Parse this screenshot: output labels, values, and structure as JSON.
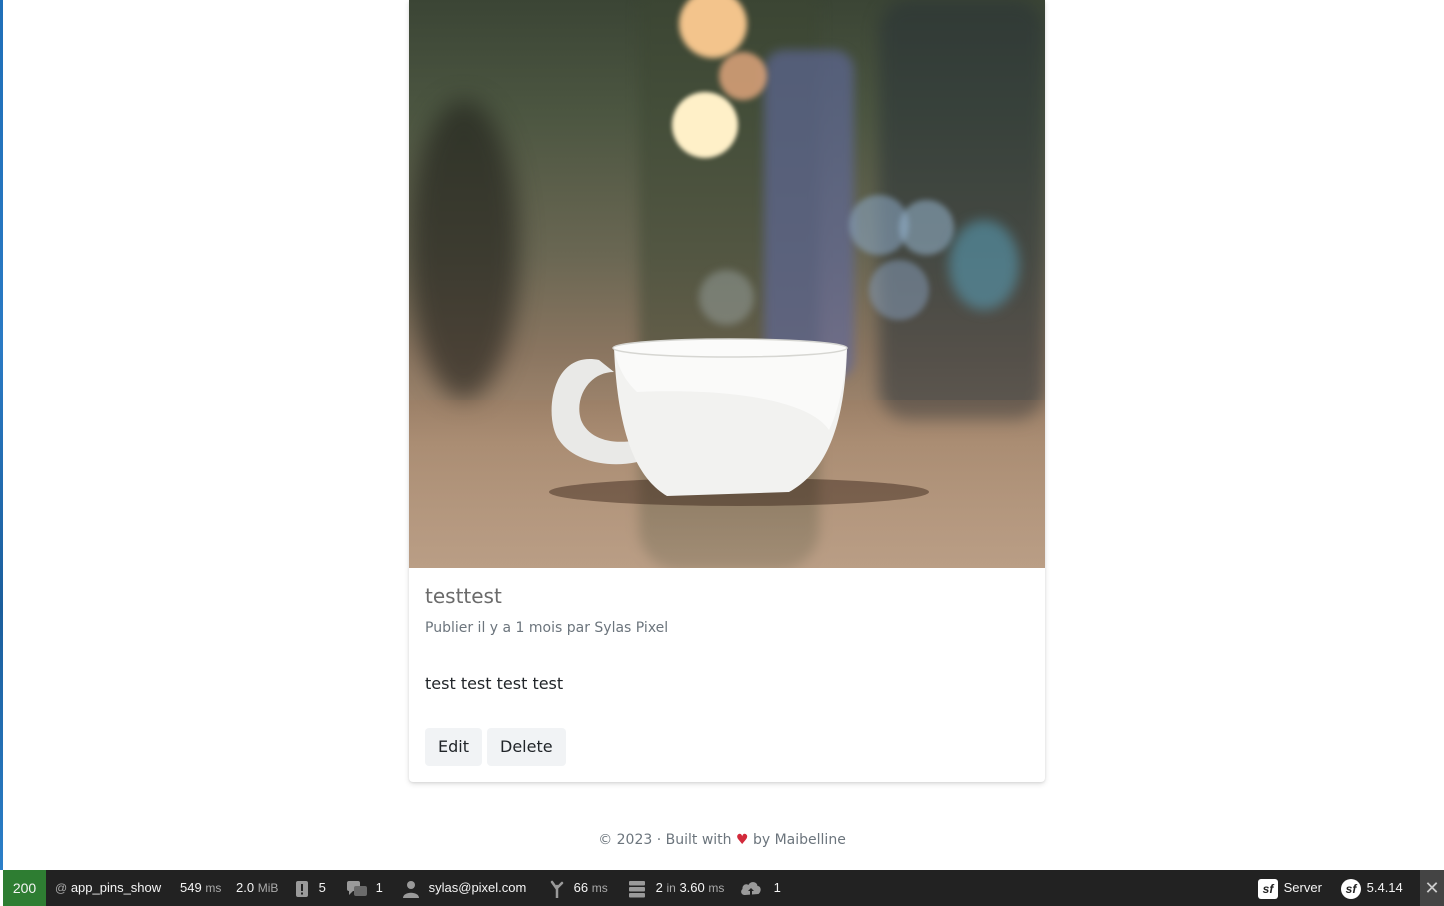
{
  "post": {
    "title": "testtest",
    "meta": "Publier il y a 1 mois par Sylas Pixel",
    "body": "test test test test",
    "edit_label": "Edit",
    "delete_label": "Delete"
  },
  "footer": {
    "prefix": "© 2023 · Built with",
    "heart": "♥",
    "suffix": "by Maibelline"
  },
  "debug_toolbar": {
    "status_code": "200",
    "route": "app_pins_show",
    "time_value": "549",
    "time_unit": "ms",
    "memory_value": "2.0",
    "memory_unit": "MiB",
    "logs_count": "5",
    "translation_count": "1",
    "user": "sylas@pixel.com",
    "twig_value": "66",
    "twig_unit": "ms",
    "db_queries": "2",
    "db_in": "in",
    "db_time": "3.60",
    "db_unit": "ms",
    "http_count": "1",
    "server_label": "Server",
    "symfony_version": "5.4.14",
    "status_color": "#2e7d32"
  }
}
